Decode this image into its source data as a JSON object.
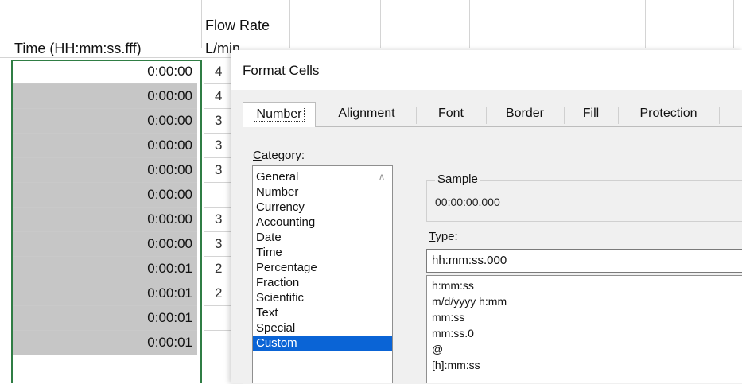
{
  "sheet": {
    "header_row1_b": "Flow Rate",
    "header_row2_a": "Time (HH:mm:ss.fff)",
    "header_row2_b": "L/min",
    "time_values": [
      "0:00:00",
      "0:00:00",
      "0:00:00",
      "0:00:00",
      "0:00:00",
      "0:00:00",
      "0:00:00",
      "0:00:00",
      "0:00:01",
      "0:00:01",
      "0:00:01",
      "0:00:01"
    ],
    "colB_partial": [
      "4",
      "4",
      "3",
      "3",
      "3",
      "",
      "3",
      "3",
      "2",
      "2",
      "",
      ""
    ]
  },
  "dialog": {
    "title": "Format Cells",
    "tabs": [
      "Number",
      "Alignment",
      "Font",
      "Border",
      "Fill",
      "Protection"
    ],
    "active_tab": "Number",
    "category_label_prefix": "C",
    "category_label_rest": "ategory:",
    "categories": [
      "General",
      "Number",
      "Currency",
      "Accounting",
      "Date",
      "Time",
      "Percentage",
      "Fraction",
      "Scientific",
      "Text",
      "Special",
      "Custom"
    ],
    "selected_category": "Custom",
    "sample_label": "Sample",
    "sample_value": "00:00:00.000",
    "type_label_prefix": "T",
    "type_label_rest": "ype:",
    "type_value": "hh:mm:ss.000",
    "type_options": [
      "h:mm:ss",
      "m/d/yyyy h:mm",
      "mm:ss",
      "mm:ss.0",
      "@",
      "[h]:mm:ss"
    ]
  },
  "colors": {
    "selection_border": "#2f7d44",
    "selected_cell_bg": "#c6c6c6",
    "list_highlight": "#0a64d6"
  }
}
